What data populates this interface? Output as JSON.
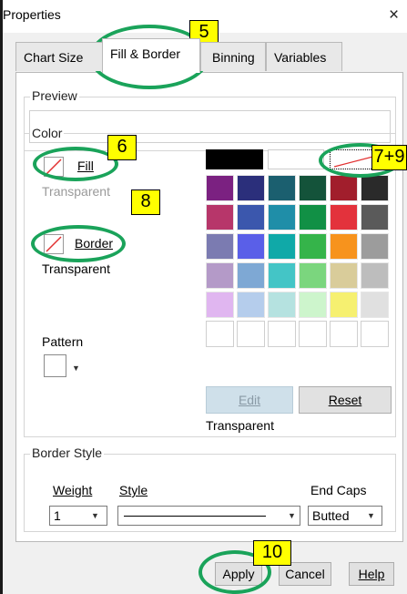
{
  "window": {
    "title": "Properties",
    "close_glyph": "×"
  },
  "tabs": [
    {
      "label": "Chart Size"
    },
    {
      "label": "Fill & Border"
    },
    {
      "label": "Binning"
    },
    {
      "label": "Variables"
    }
  ],
  "preview": {
    "legend": "Preview"
  },
  "color": {
    "legend": "Color",
    "fill_label": "Fill",
    "fill_value": "Transparent",
    "border_label": "Border",
    "border_value": "Transparent",
    "pattern_label": "Pattern",
    "edit_label": "Edit",
    "reset_label": "Reset",
    "selected_caption": "Transparent",
    "palette_colors": [
      [
        "#000000",
        "#ffffff",
        "transparent"
      ],
      [
        "#7b2181",
        "#2b2f7b",
        "#1b5f6f",
        "#14533a",
        "#a11e2c",
        "#2a2a2a"
      ],
      [
        "#b7366a",
        "#3b57ad",
        "#1f8ea8",
        "#119045",
        "#e3323c",
        "#5a5a5a"
      ],
      [
        "#7b7bb1",
        "#5a5fe8",
        "#10a9a8",
        "#35b44a",
        "#f7931d",
        "#9c9c9c"
      ],
      [
        "#b49ac8",
        "#7ea8d4",
        "#44c5c6",
        "#7bd67e",
        "#d9cc9a",
        "#bdbdbd"
      ],
      [
        "#e0b6f0",
        "#b5cdec",
        "#b5e2e0",
        "#cdf5cc",
        "#f6f070",
        "#e0e0e0"
      ],
      [
        "#ffffff",
        "#ffffff",
        "#ffffff",
        "#ffffff",
        "#ffffff",
        "#ffffff"
      ]
    ]
  },
  "border_style": {
    "legend": "Border Style",
    "weight_label": "Weight",
    "weight_value": "1",
    "style_label": "Style",
    "end_caps_label": "End Caps",
    "end_caps_value": "Butted"
  },
  "buttons": {
    "apply": "Apply",
    "cancel": "Cancel",
    "help": "Help"
  },
  "annotations": [
    {
      "label": "5"
    },
    {
      "label": "6"
    },
    {
      "label": "7+9"
    },
    {
      "label": "8"
    },
    {
      "label": "10"
    }
  ],
  "colors": {
    "annotation_ring": "#1aa35a",
    "annotation_tag": "#ffff00"
  }
}
